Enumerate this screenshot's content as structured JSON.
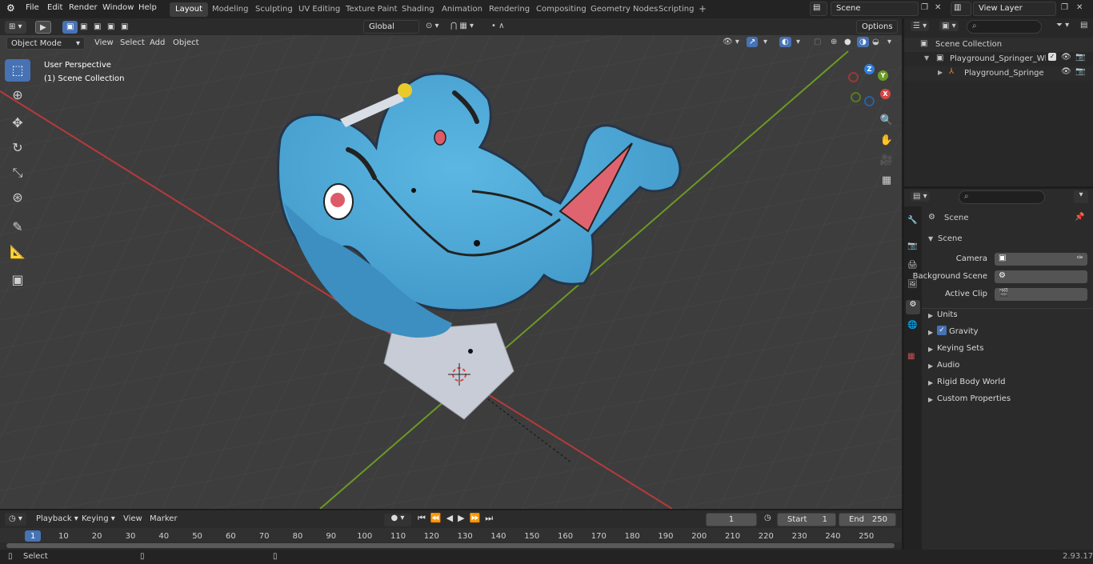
{
  "menubar": {
    "items": [
      "File",
      "Edit",
      "Render",
      "Window",
      "Help"
    ],
    "workspaces": [
      "Layout",
      "Modeling",
      "Sculpting",
      "UV Editing",
      "Texture Paint",
      "Shading",
      "Animation",
      "Rendering",
      "Compositing",
      "Geometry Nodes",
      "Scripting"
    ],
    "active_workspace": "Layout",
    "scene_name": "Scene",
    "view_layer": "View Layer"
  },
  "viewport_header": {
    "mode": "Object Mode",
    "menus": [
      "View",
      "Select",
      "Add",
      "Object"
    ],
    "transform_orientation": "Global",
    "options_label": "Options"
  },
  "viewport": {
    "perspective_label": "User Perspective",
    "collection_label": "(1) Scene Collection",
    "gizmo_axes": [
      "Z",
      "Y",
      "X"
    ]
  },
  "outliner": {
    "search_placeholder": "",
    "root": "Scene Collection",
    "rows": [
      {
        "label": "Playground_Springer_Whale_("
      },
      {
        "label": "Playground_Springer_Wh"
      }
    ]
  },
  "properties": {
    "context_title": "Scene",
    "section": "Scene",
    "fields": [
      {
        "label": "Camera"
      },
      {
        "label": "Background Scene"
      },
      {
        "label": "Active Clip"
      }
    ],
    "panels": [
      "Units",
      "Gravity",
      "Keying Sets",
      "Audio",
      "Rigid Body World",
      "Custom Properties"
    ],
    "gravity_checked": true
  },
  "timeline": {
    "menus": [
      "Playback",
      "Keying",
      "View",
      "Marker"
    ],
    "current_frame": "1",
    "start_label": "Start",
    "start_value": "1",
    "end_label": "End",
    "end_value": "250",
    "ticks": [
      "1",
      "10",
      "20",
      "30",
      "40",
      "50",
      "60",
      "70",
      "80",
      "90",
      "100",
      "110",
      "120",
      "130",
      "140",
      "150",
      "160",
      "170",
      "180",
      "190",
      "200",
      "210",
      "220",
      "230",
      "240",
      "250"
    ]
  },
  "statusbar": {
    "left_label": "Select",
    "version": "2.93.17"
  },
  "colors": {
    "accent": "#4772b3",
    "whale_body": "#4fa9d6",
    "base": "#c7ccd6",
    "axis_x": "#b73a3a",
    "axis_y": "#6b9a25"
  }
}
